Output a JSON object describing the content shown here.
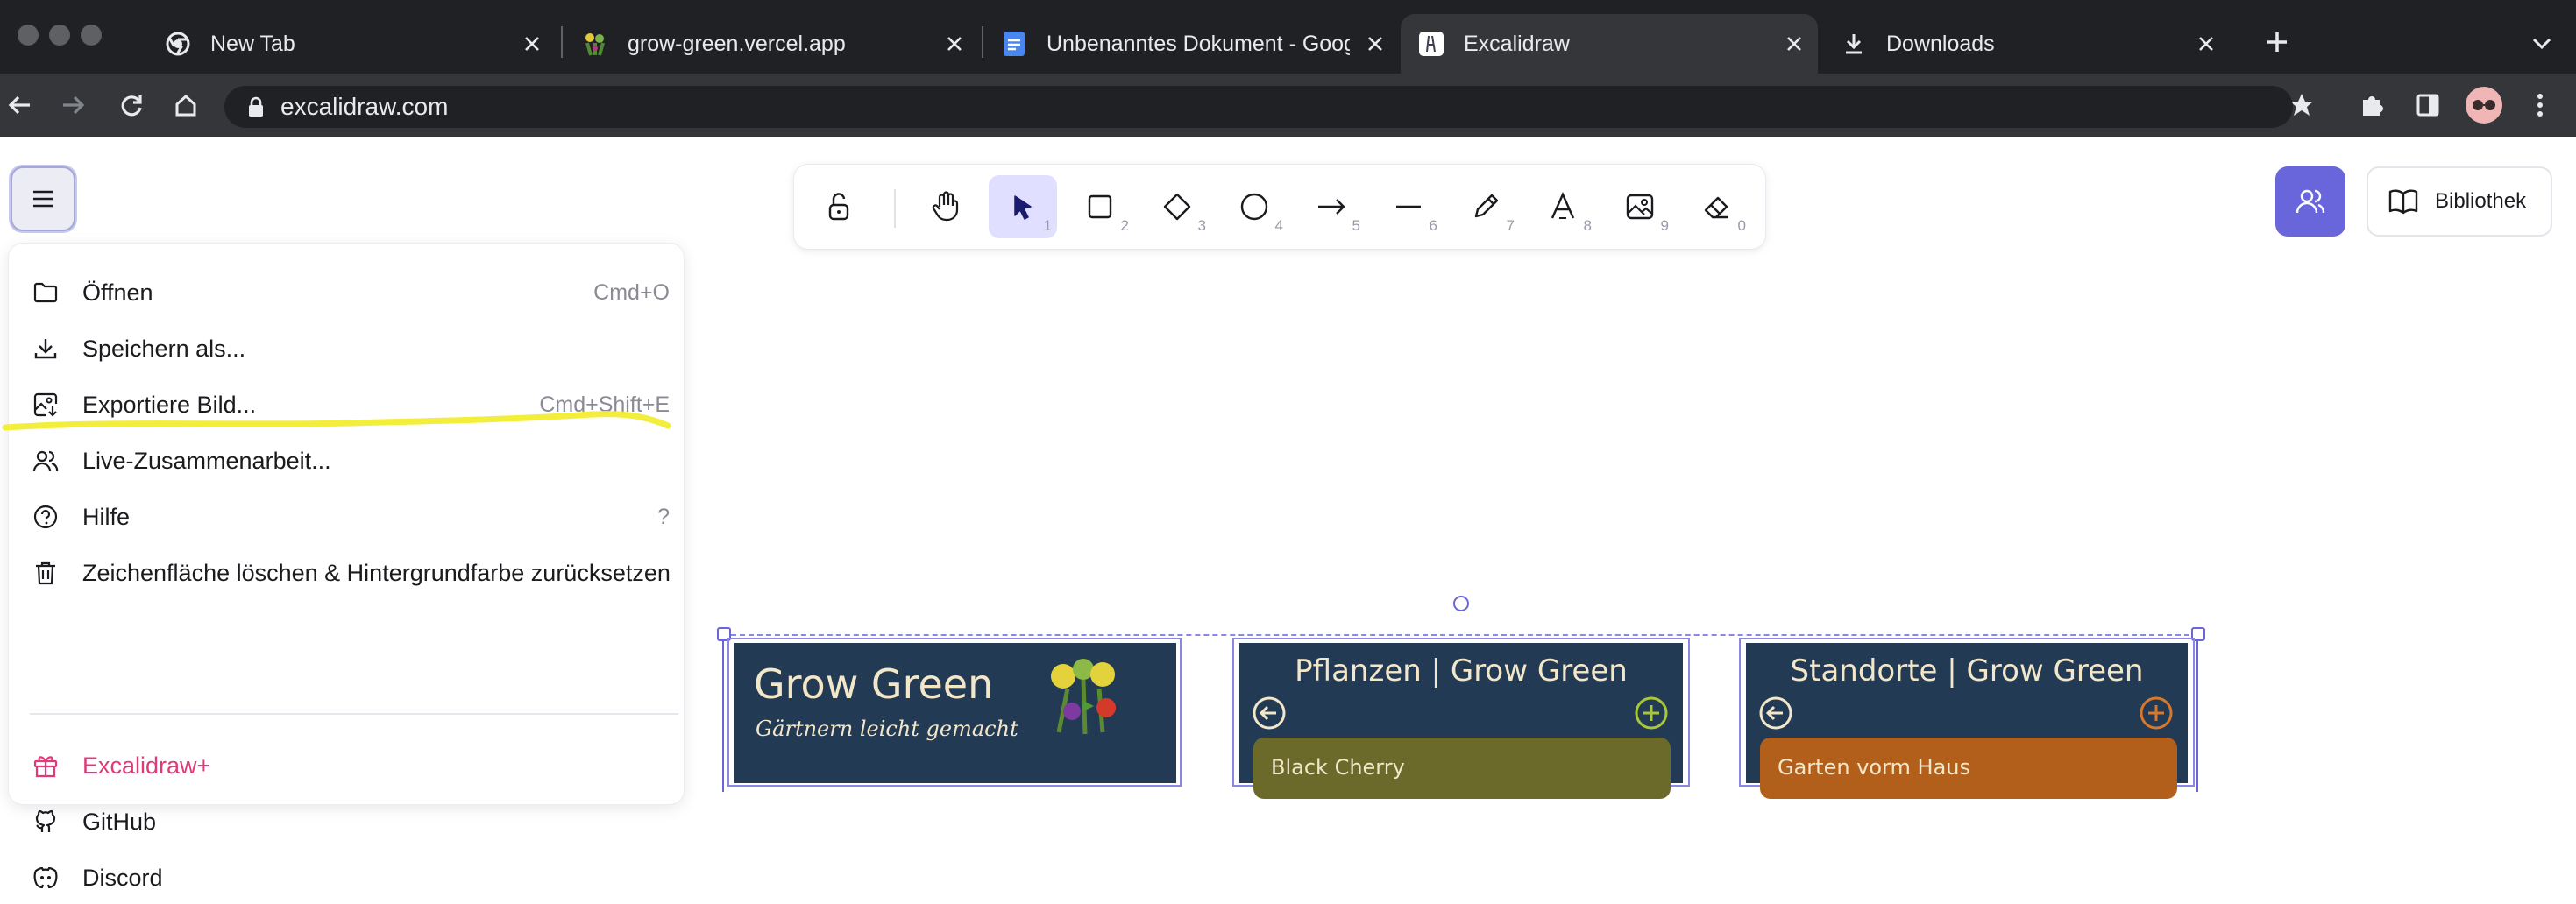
{
  "browser": {
    "tabs": [
      {
        "title": "New Tab",
        "icon": "chrome-icon",
        "active": false
      },
      {
        "title": "grow-green.vercel.app",
        "icon": "grow-green-favicon",
        "active": false
      },
      {
        "title": "Unbenanntes Dokument - Google Docs",
        "icon": "google-docs-icon",
        "active": false
      },
      {
        "title": "Excalidraw",
        "icon": "excalidraw-favicon",
        "active": true
      },
      {
        "title": "Downloads",
        "icon": "download-icon",
        "active": false
      }
    ],
    "url": "excalidraw.com"
  },
  "toolbar": {
    "tools": [
      {
        "name": "hand-tool",
        "num": ""
      },
      {
        "name": "selection-tool",
        "num": "1"
      },
      {
        "name": "rectangle-tool",
        "num": "2"
      },
      {
        "name": "diamond-tool",
        "num": "3"
      },
      {
        "name": "ellipse-tool",
        "num": "4"
      },
      {
        "name": "arrow-tool",
        "num": "5"
      },
      {
        "name": "line-tool",
        "num": "6"
      },
      {
        "name": "pencil-tool",
        "num": "7"
      },
      {
        "name": "text-tool",
        "num": "8"
      },
      {
        "name": "image-tool",
        "num": "9"
      },
      {
        "name": "eraser-tool",
        "num": "0"
      }
    ],
    "library_label": "Bibliothek"
  },
  "menu": {
    "items": [
      {
        "label": "Öffnen",
        "shortcut": "Cmd+O",
        "icon": "folder-icon"
      },
      {
        "label": "Speichern als...",
        "shortcut": "",
        "icon": "download-icon"
      },
      {
        "label": "Exportiere Bild...",
        "shortcut": "Cmd+Shift+E",
        "icon": "export-image-icon"
      },
      {
        "label": "Live-Zusammenarbeit...",
        "shortcut": "",
        "icon": "users-icon"
      },
      {
        "label": "Hilfe",
        "shortcut": "?",
        "icon": "help-icon"
      },
      {
        "label": "Zeichenfläche löschen & Hintergrundfarbe zurücksetzen",
        "shortcut": "",
        "icon": "trash-icon"
      }
    ],
    "links": [
      {
        "label": "Excalidraw+",
        "icon": "gift-icon",
        "color": "#e03a78"
      },
      {
        "label": "GitHub",
        "icon": "github-icon"
      },
      {
        "label": "Discord",
        "icon": "discord-icon"
      }
    ]
  },
  "canvas": {
    "frames": [
      {
        "title": "Grow Green",
        "subtitle": "Gärtnern leicht gemacht"
      },
      {
        "title": "Pflanzen | Grow Green",
        "card": "Black Cherry",
        "card_color": "#6b6a2a"
      },
      {
        "title": "Standorte | Grow Green",
        "card": "Garten vorm Haus",
        "card_color": "#b35f1c"
      }
    ],
    "highlight_color": "#f2ee3b",
    "accent": "#6965db"
  }
}
